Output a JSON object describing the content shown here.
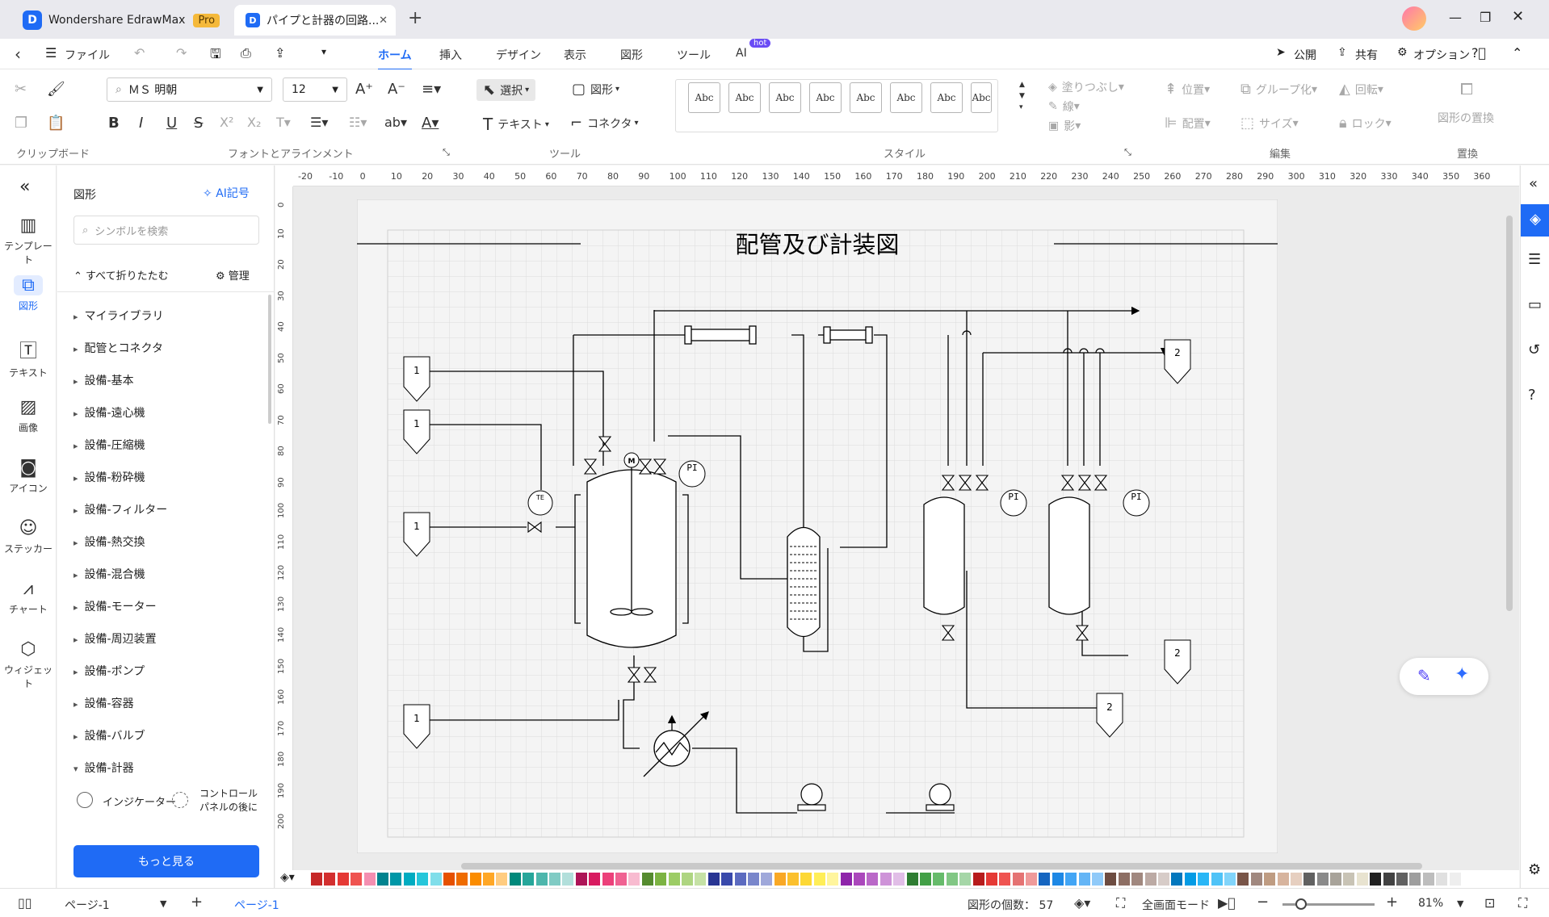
{
  "titlebar": {
    "app_name": "Wondershare EdrawMax",
    "pro_badge": "Pro",
    "doc_tab": "パイプと計器の回路...",
    "new_tab": "+",
    "minimize": "—",
    "restore": "❐",
    "close": "✕"
  },
  "menu": {
    "file": "ファイル",
    "tabs": [
      "ホーム",
      "挿入",
      "デザイン",
      "表示",
      "図形",
      "ツール",
      "AI"
    ],
    "ai_badge": "hot",
    "publish": "公開",
    "share": "共有",
    "options": "オプション"
  },
  "ribbon": {
    "font_name": "ＭＳ 明朝",
    "font_size": "12",
    "select": "選択",
    "shape": "図形",
    "text": "テキスト",
    "connector": "コネクタ",
    "abc": "Abc",
    "fill": "塗りつぶし",
    "line": "線",
    "shadow": "影",
    "position": "位置",
    "group": "グループ化",
    "rotate": "回転",
    "arrange": "配置",
    "size": "サイズ",
    "lock": "ロック",
    "replace": "図形の置換",
    "group_labels": [
      "クリップボード",
      "フォントとアラインメント",
      "ツール",
      "スタイル",
      "編集",
      "置換"
    ]
  },
  "leftnav": [
    "テンプレート",
    "図形",
    "テキスト",
    "画像",
    "アイコン",
    "ステッカー",
    "チャート",
    "ウィジェット"
  ],
  "panel": {
    "title": "図形",
    "ai_symbol": "AI記号",
    "search_placeholder": "シンボルを検索",
    "collapse_all": "すべて折りたたむ",
    "manage": "管理",
    "libraries": [
      "マイライブラリ",
      "配管とコネクタ",
      "設備-基本",
      "設備-遠心機",
      "設備-圧縮機",
      "設備-粉砕機",
      "設備-フィルター",
      "設備-熱交換",
      "設備-混合機",
      "設備-モーター",
      "設備-周辺装置",
      "設備-ポンプ",
      "設備-容器",
      "設備-バルブ",
      "設備-計器"
    ],
    "shapes": [
      "インジケーター",
      "コントロールパネルの後に"
    ],
    "more": "もっと見る"
  },
  "ruler": [
    "-20",
    "-10",
    "0",
    "10",
    "20",
    "30",
    "40",
    "50",
    "60",
    "70",
    "80",
    "90",
    "100",
    "110",
    "120",
    "130",
    "140",
    "150",
    "160",
    "170",
    "180",
    "190",
    "200",
    "210",
    "220",
    "230",
    "240",
    "250",
    "260",
    "270",
    "280",
    "290",
    "300",
    "310",
    "320",
    "330",
    "340",
    "350",
    "360"
  ],
  "vruler": [
    "0",
    "10",
    "20",
    "30",
    "40",
    "50",
    "60",
    "70",
    "80",
    "90",
    "100",
    "110",
    "120",
    "130",
    "140",
    "150",
    "160",
    "170",
    "180",
    "190",
    "200"
  ],
  "diagram": {
    "title": "配管及び計装図",
    "tag_1": "1",
    "tag_2": "2",
    "pi": "PI",
    "te": "TE",
    "m": "M"
  },
  "status": {
    "page_selector": "ページ-1",
    "page_tab": "ページ-1",
    "shape_count": "図形の個数： 57",
    "fullscreen": "全画面モード",
    "zoom": "81%"
  },
  "palette_colors": [
    "#c62828",
    "#d32f2f",
    "#e53935",
    "#ef5350",
    "#f48fb1",
    "#00838f",
    "#0097a7",
    "#00acc1",
    "#26c6da",
    "#80deea",
    "#e65100",
    "#ef6c00",
    "#fb8c00",
    "#ffa726",
    "#ffcc80",
    "#00897b",
    "#26a69a",
    "#4db6ac",
    "#80cbc4",
    "#b2dfdb",
    "#ad1457",
    "#d81b60",
    "#ec407a",
    "#f06292",
    "#f8bbd0",
    "#558b2f",
    "#7cb342",
    "#9ccc65",
    "#aed581",
    "#c5e1a5",
    "#283593",
    "#3949ab",
    "#5c6bc0",
    "#7986cb",
    "#9fa8da",
    "#f9a825",
    "#fbc02d",
    "#fdd835",
    "#ffee58",
    "#fff59d",
    "#8e24aa",
    "#ab47bc",
    "#ba68c8",
    "#ce93d8",
    "#e1bee7",
    "#2e7d32",
    "#43a047",
    "#66bb6a",
    "#81c784",
    "#a5d6a7",
    "#b71c1c",
    "#e53935",
    "#ef5350",
    "#e57373",
    "#ef9a9a",
    "#1565c0",
    "#1e88e5",
    "#42a5f5",
    "#64b5f6",
    "#90caf9",
    "#6d4c41",
    "#8d6e63",
    "#a1887f",
    "#bcaaa4",
    "#d7ccc8",
    "#0277bd",
    "#039be5",
    "#29b6f6",
    "#4fc3f7",
    "#81d4fa",
    "#795548",
    "#a1887f",
    "#bf9c82",
    "#d7b49e",
    "#e6cfc0",
    "#616161",
    "#8a8a8a",
    "#a8a39a",
    "#c8c3b5",
    "#e8e3d0",
    "#212121",
    "#424242",
    "#616161",
    "#9e9e9e",
    "#bdbdbd",
    "#e0e0e0",
    "#eeeeee",
    "#ffffff"
  ]
}
